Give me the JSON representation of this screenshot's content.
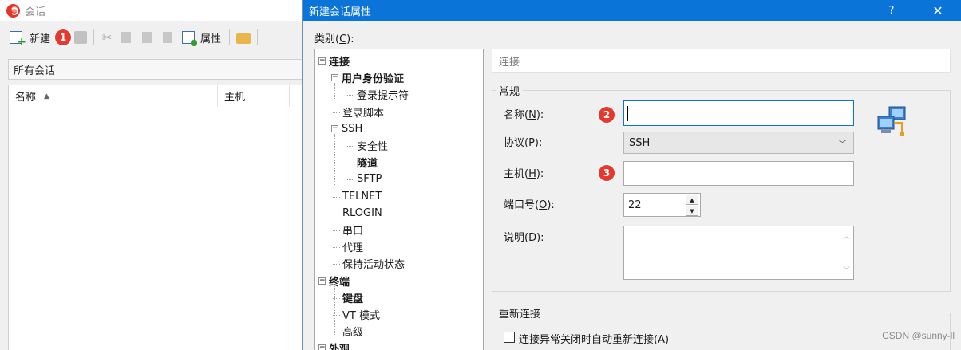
{
  "sessions_window": {
    "title": "会话",
    "toolbar": {
      "new_label": "新建",
      "properties_label": "属性",
      "step_badge": "1"
    },
    "all_sessions_label": "所有会话",
    "columns": {
      "name": "名称",
      "host": "主机"
    }
  },
  "dialog": {
    "title": "新建会话属性",
    "help_label": "?",
    "close_label": "✕",
    "category_label": "类别(C):",
    "category_label_prefix": "类别(",
    "category_label_key": "C",
    "category_label_suffix": "):",
    "tree": [
      {
        "label": "连接",
        "level": 0,
        "expand": "−",
        "bold": true
      },
      {
        "label": "用户身份验证",
        "level": 1,
        "expand": "−",
        "bold": true
      },
      {
        "label": "登录提示符",
        "level": 2,
        "bold": false
      },
      {
        "label": "登录脚本",
        "level": 1,
        "bold": false
      },
      {
        "label": "SSH",
        "level": 1,
        "expand": "−",
        "bold": false
      },
      {
        "label": "安全性",
        "level": 2,
        "bold": false
      },
      {
        "label": "隧道",
        "level": 2,
        "bold": true
      },
      {
        "label": "SFTP",
        "level": 2,
        "bold": false
      },
      {
        "label": "TELNET",
        "level": 1,
        "bold": false
      },
      {
        "label": "RLOGIN",
        "level": 1,
        "bold": false
      },
      {
        "label": "串口",
        "level": 1,
        "bold": false
      },
      {
        "label": "代理",
        "level": 1,
        "bold": false
      },
      {
        "label": "保持活动状态",
        "level": 1,
        "bold": false
      },
      {
        "label": "终端",
        "level": 0,
        "expand": "−",
        "bold": true
      },
      {
        "label": "键盘",
        "level": 1,
        "bold": true
      },
      {
        "label": "VT 模式",
        "level": 1,
        "bold": false
      },
      {
        "label": "高级",
        "level": 1,
        "bold": false
      },
      {
        "label": "外观",
        "level": 0,
        "expand": "−",
        "bold": true
      }
    ],
    "panel_header": "连接",
    "general_group": {
      "title": "常规",
      "name": {
        "label": "名称(N):",
        "prefix": "名称(",
        "key": "N",
        "suffix": "):",
        "value": "",
        "badge": "2"
      },
      "protocol": {
        "label": "协议(P):",
        "prefix": "协议(",
        "key": "P",
        "suffix": "):",
        "value": "SSH"
      },
      "host": {
        "label": "主机(H):",
        "prefix": "主机(",
        "key": "H",
        "suffix": "):",
        "value": "",
        "badge": "3"
      },
      "port": {
        "label": "端口号(O):",
        "prefix": "端口号(",
        "key": "O",
        "suffix": "):",
        "value": "22"
      },
      "description": {
        "label": "说明(D):",
        "prefix": "说明(",
        "key": "D",
        "suffix": "):",
        "value": ""
      }
    },
    "reconnect_group": {
      "title": "重新连接",
      "auto_reconnect": {
        "label": "连接异常关闭时自动重新连接(A)",
        "prefix": "连接异常关闭时自动重新连接(",
        "key": "A",
        "suffix": ")",
        "checked": false
      }
    }
  },
  "watermark": "CSDN @sunny-ll",
  "colors": {
    "titlebar": "#0a74d8",
    "badge": "#e8382e",
    "focus": "#0a74d8"
  }
}
